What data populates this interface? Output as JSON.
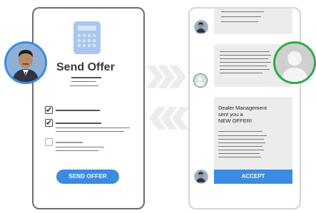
{
  "left_phone": {
    "title": "Send Offer",
    "send_button_label": "SEND OFFER",
    "checklist": [
      {
        "checked": true
      },
      {
        "checked": true
      },
      {
        "checked": false
      }
    ]
  },
  "right_phone": {
    "message_line_1": "Dealer Management",
    "message_line_2": "sent you a",
    "message_line_3": "NEW OFFER!",
    "accept_button_label": "ACCEPT"
  },
  "colors": {
    "accent_blue": "#3b8be0",
    "online_green": "#2faa4a",
    "icon_blue": "#a9c7ee",
    "arrow_gray": "#ececec"
  },
  "icons": [
    "calculator-icon",
    "checkbox-icon",
    "person-placeholder-icon",
    "arrow-right-icon",
    "arrow-left-icon"
  ]
}
